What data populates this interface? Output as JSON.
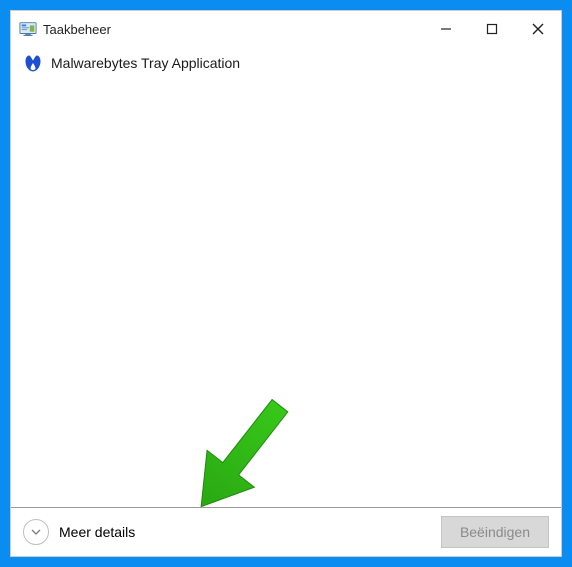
{
  "window": {
    "title": "Taakbeheer"
  },
  "process": {
    "name": "Malwarebytes Tray Application"
  },
  "footer": {
    "more_details": "Meer details",
    "end_task": "Beëindigen"
  }
}
